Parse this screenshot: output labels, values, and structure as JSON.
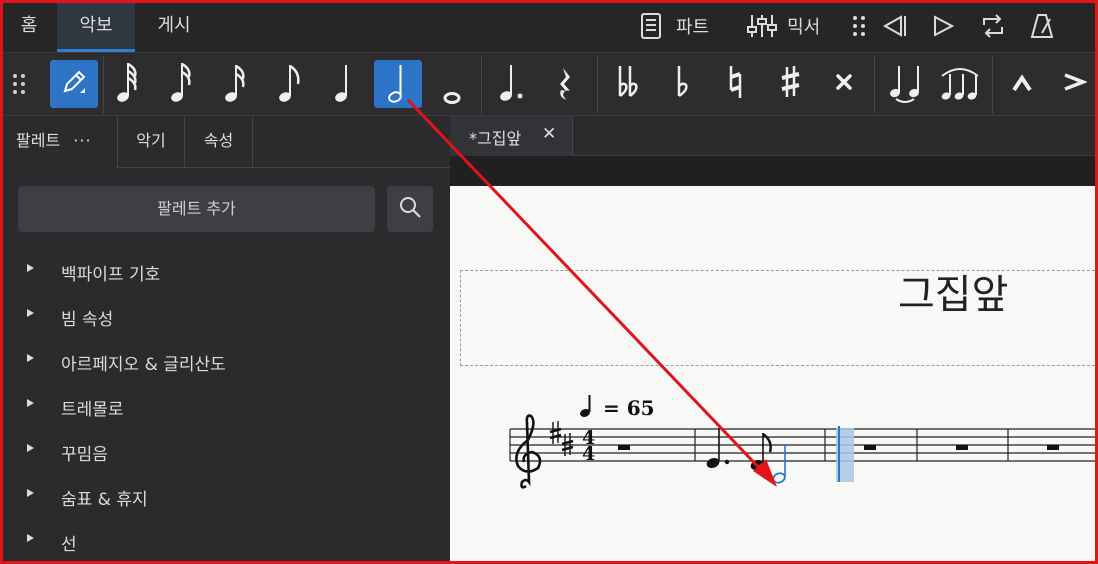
{
  "nav": {
    "tabs": [
      {
        "label": "홈"
      },
      {
        "label": "악보"
      },
      {
        "label": "게시"
      }
    ],
    "parts_label": "파트",
    "mixer_label": "믹서"
  },
  "note_input": {
    "tools": [
      "pen",
      "64th",
      "32nd",
      "16th",
      "eighth",
      "quarter",
      "half",
      "whole",
      "augmentation-dot",
      "rest",
      "double-flat",
      "flat",
      "natural",
      "sharp",
      "double-sharp",
      "tie",
      "slur",
      "marcato",
      "accent"
    ],
    "selected_duration": "half"
  },
  "panel": {
    "tabs": [
      {
        "label": "팔레트"
      },
      {
        "label": "악기"
      },
      {
        "label": "속성"
      }
    ],
    "more_label": "···",
    "add_palette_label": "팔레트 추가",
    "items": [
      {
        "label": "백파이프 기호"
      },
      {
        "label": "빔 속성"
      },
      {
        "label": "아르페지오 & 글리산도"
      },
      {
        "label": "트레몰로"
      },
      {
        "label": "꾸밈음"
      },
      {
        "label": "숨표 & 휴지"
      },
      {
        "label": "선"
      }
    ]
  },
  "document": {
    "tab_label": "*그집앞",
    "close_glyph": "✕",
    "title": "그집앞",
    "tempo_text": "= 65",
    "time_signature": {
      "top": "4",
      "bottom": "4"
    },
    "key": "D major"
  },
  "colors": {
    "accent": "#2e74c6",
    "annotation": "#e1141a",
    "selection": "#a9c8e6"
  }
}
